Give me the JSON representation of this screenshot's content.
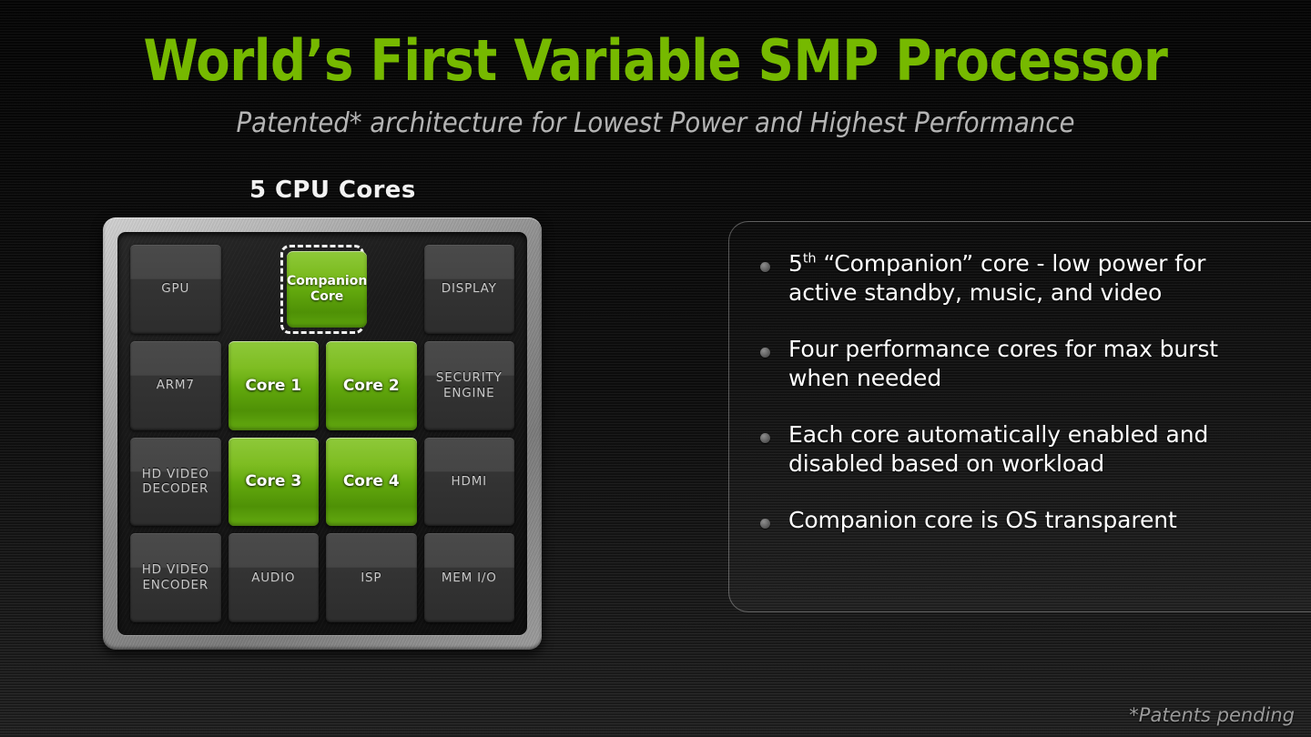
{
  "header": {
    "title": "World’s First Variable SMP Processor",
    "subtitle": "Patented* architecture for Lowest Power and Highest Performance"
  },
  "chip": {
    "heading": "5 CPU Cores",
    "blocks": {
      "gpu": "GPU",
      "display": "DISPLAY",
      "arm7": "ARM7",
      "security_engine": "SECURITY ENGINE",
      "hd_video_decoder": "HD VIDEO DECODER",
      "hdmi": "HDMI",
      "hd_video_encoder": "HD VIDEO ENCODER",
      "audio": "AUDIO",
      "isp": "ISP",
      "mem_io": "MEM I/O"
    },
    "cores": {
      "companion_line1": "Companion",
      "companion_line2": "Core",
      "core1": "Core 1",
      "core2": "Core 2",
      "core3": "Core 3",
      "core4": "Core 4"
    }
  },
  "bullets": [
    {
      "prefix": "5",
      "superscript": "th",
      "text": " “Companion” core - low power for active standby, music, and video"
    },
    {
      "prefix": "",
      "superscript": "",
      "text": "Four performance cores for max burst when needed"
    },
    {
      "prefix": "",
      "superscript": "",
      "text": "Each core automatically enabled and disabled based on workload"
    },
    {
      "prefix": "",
      "superscript": "",
      "text": "Companion core is OS transparent"
    }
  ],
  "footer": {
    "note": "*Patents pending"
  },
  "colors": {
    "title_green": "#76b900",
    "core_green": "#62a80d",
    "body_text": "#ffffff",
    "subtitle_gray": "#b4b4b4",
    "footer_gray": "#9a9a9a"
  }
}
